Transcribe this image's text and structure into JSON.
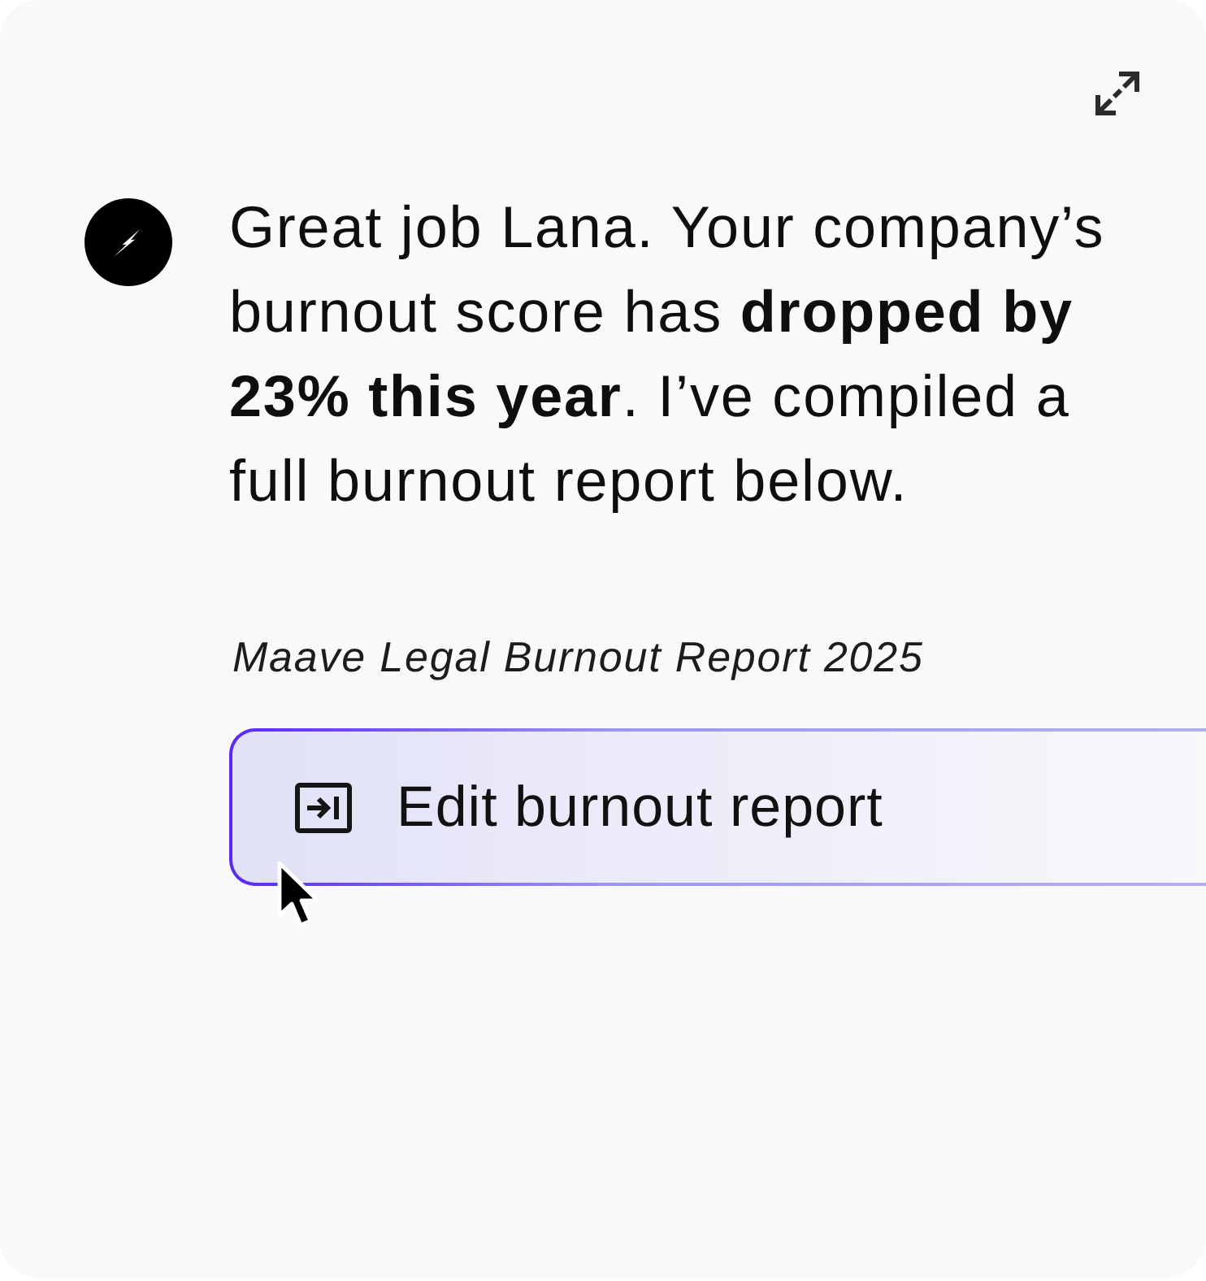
{
  "message": {
    "text": "Great job Lana. Your company’s burnout score has **dropped by 23% this year**. I’ve compiled a full burnout report below."
  },
  "report": {
    "title": "Maave Legal Burnout Report 2025",
    "button": {
      "label": "Edit burnout report"
    }
  }
}
